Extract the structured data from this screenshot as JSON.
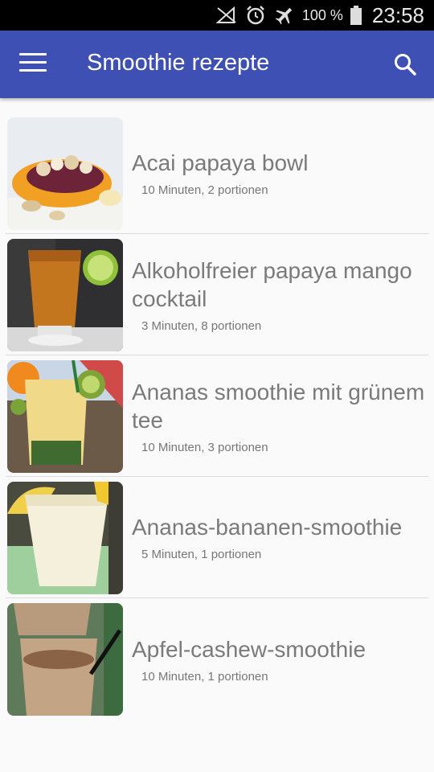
{
  "statusbar": {
    "battery_percent": "100 %",
    "time": "23:58",
    "icons": [
      "no-signal-icon",
      "alarm-icon",
      "airplane-mode-icon",
      "battery-icon"
    ]
  },
  "appbar": {
    "title": "Smoothie rezepte",
    "menu_icon": "hamburger-menu-icon",
    "search_icon": "search-icon",
    "color": "#3e50b4"
  },
  "recipes": [
    {
      "title": "Acai papaya bowl",
      "meta": "10 Minuten, 2 portionen",
      "image": "acai-papaya-bowl-photo"
    },
    {
      "title": "Alkoholfreier papaya mango cocktail",
      "meta": "3 Minuten, 8 portionen",
      "image": "papaya-mango-cocktail-photo"
    },
    {
      "title": "Ananas smoothie mit grünem tee",
      "meta": "10 Minuten, 3 portionen",
      "image": "ananas-green-tea-smoothie-photo"
    },
    {
      "title": "Ananas-bananen-smoothie",
      "meta": "5 Minuten, 1 portionen",
      "image": "ananas-banana-smoothie-photo"
    },
    {
      "title": "Apfel-cashew-smoothie",
      "meta": "10 Minuten, 1 portionen",
      "image": "apple-cashew-smoothie-photo"
    }
  ]
}
